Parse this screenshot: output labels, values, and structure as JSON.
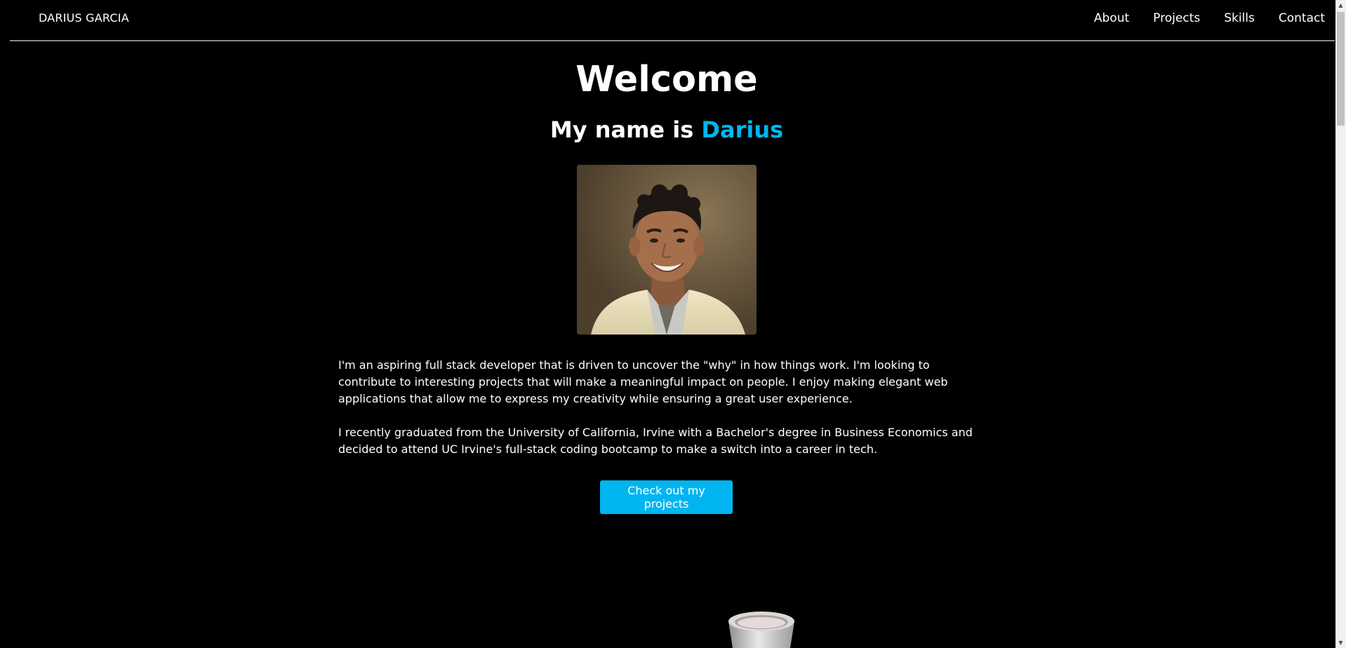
{
  "navbar": {
    "brand": "DARIUS GARCIA",
    "links": [
      "About",
      "Projects",
      "Skills",
      "Contact"
    ]
  },
  "hero": {
    "heading": "Welcome",
    "intro_prefix": "My name is ",
    "intro_name": "Darius",
    "portrait_alt": "Portrait of Darius Garcia",
    "bio": [
      "I'm an aspiring full stack developer that is driven to uncover the \"why\" in how things work. I'm looking to contribute to interesting projects that will make a meaningful impact on people. I enjoy making elegant web applications that allow me to express my creativity while ensuring a great user experience.",
      "I recently graduated from the University of California, Irvine with a Bachelor's degree in Business Economics and decided to attend UC Irvine's full-stack coding bootcamp to make a switch into a career in tech."
    ],
    "cta_label": "Check out my projects"
  },
  "colors": {
    "background": "#000000",
    "accent": "#00b5f0",
    "text": "#ffffff",
    "divider": "#8a8a8a"
  },
  "icons": {
    "scroll_up": "triangle-up-icon",
    "scroll_down": "triangle-down-icon"
  }
}
